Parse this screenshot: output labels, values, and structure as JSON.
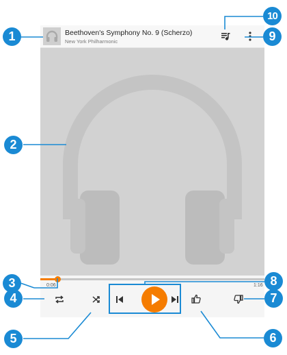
{
  "now_playing": {
    "title": "Beethoven's Symphony No. 9 (Scherzo)",
    "artist": "New York Philharmonic"
  },
  "playback": {
    "elapsed": "0:06",
    "duration": "1:16",
    "progress_fraction": 0.077,
    "state": "paused"
  },
  "icons": {
    "thumbnail": "headphones-icon",
    "queue": "queue-music-icon",
    "menu": "more-vert-icon",
    "album_art": "headphones-icon",
    "repeat": "repeat-icon",
    "shuffle": "shuffle-icon",
    "previous": "skip-previous-icon",
    "play": "play-icon",
    "next": "skip-next-icon",
    "thumbs_up": "thumbs-up-icon",
    "thumbs_down": "thumbs-down-icon"
  },
  "callouts": [
    "1",
    "2",
    "3",
    "4",
    "5",
    "6",
    "7",
    "8",
    "9",
    "10"
  ],
  "colors": {
    "accent": "#f57c00",
    "callout": "#1a8ad4",
    "art_background": "#d2d2d2",
    "headphones": "#c4c4c4"
  }
}
